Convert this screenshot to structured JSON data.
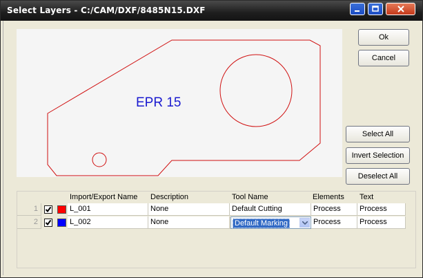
{
  "window": {
    "title": "Select Layers - C:/CAM/DXF/8485N15.DXF",
    "controls": {
      "minimize": "minimize",
      "maximize": "maximize",
      "close": "close"
    }
  },
  "preview": {
    "label": "EPR 15",
    "label_color": "#1a1ad0",
    "outline_color": "#d01010"
  },
  "buttons": {
    "ok": "Ok",
    "cancel": "Cancel",
    "select_all": "Select All",
    "invert_selection": "Invert Selection",
    "deselect_all": "Deselect All"
  },
  "table": {
    "columns": [
      "Import/Export Name",
      "Description",
      "Tool Name",
      "Elements",
      "Text"
    ],
    "rows": [
      {
        "num": "1",
        "checked": true,
        "color": "#ff0000",
        "name": "L_001",
        "description": "None",
        "tool": "Default Cutting",
        "elements": "Process",
        "text": "Process"
      },
      {
        "num": "2",
        "checked": true,
        "color": "#0000ff",
        "name": "L_002",
        "description": "None",
        "tool": "Default Marking",
        "elements": "Process",
        "text": "Process"
      }
    ]
  }
}
